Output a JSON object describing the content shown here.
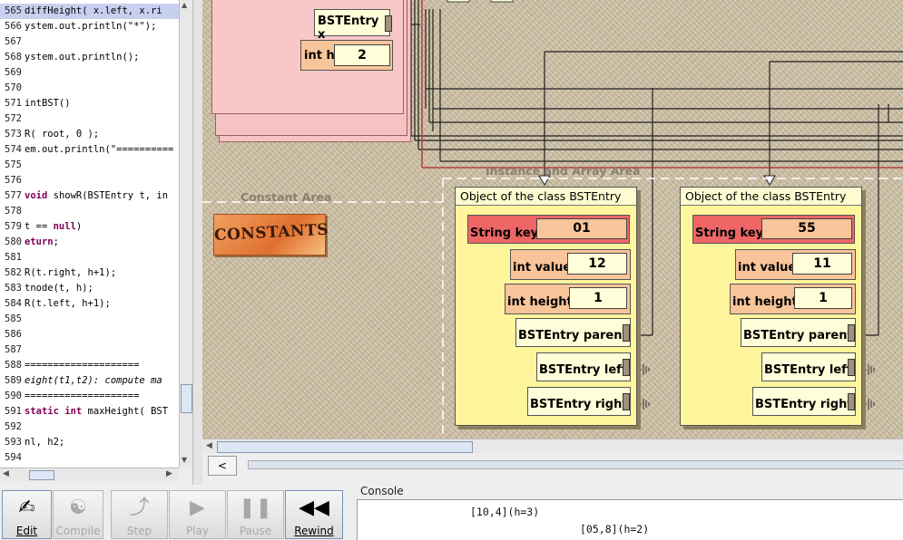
{
  "editor": {
    "lines": [
      {
        "num": "565",
        "text": " diffHeight( x.left, x.ri",
        "current": true
      },
      {
        "num": "566",
        "text": "ystem.out.println(\"*\");"
      },
      {
        "num": "567",
        "text": ""
      },
      {
        "num": "568",
        "text": "ystem.out.println();"
      },
      {
        "num": "569",
        "text": ""
      },
      {
        "num": "570",
        "text": ""
      },
      {
        "num": "571",
        "text": "intBST()"
      },
      {
        "num": "572",
        "text": ""
      },
      {
        "num": "573",
        "text": "R( root, 0 );"
      },
      {
        "num": "574",
        "text": "em.out.println(\"=========="
      },
      {
        "num": "575",
        "text": ""
      },
      {
        "num": "576",
        "text": ""
      },
      {
        "num": "577",
        "pre": "",
        "kw": "void",
        "post": " showR(BSTEntry t, in"
      },
      {
        "num": "578",
        "text": ""
      },
      {
        "num": "579",
        "pre": "t == ",
        "kw": "null",
        "post": ")"
      },
      {
        "num": "580",
        "pre": "",
        "kw": "eturn",
        "post": ";"
      },
      {
        "num": "581",
        "text": ""
      },
      {
        "num": "582",
        "text": "R(t.right, h+1);"
      },
      {
        "num": "583",
        "text": "tnode(t, h);"
      },
      {
        "num": "584",
        "text": "R(t.left, h+1);"
      },
      {
        "num": "585",
        "text": ""
      },
      {
        "num": "586",
        "text": ""
      },
      {
        "num": "587",
        "text": ""
      },
      {
        "num": "588",
        "text": "===================="
      },
      {
        "num": "589",
        "text": "eight(t1,t2): compute ma",
        "italic": true
      },
      {
        "num": "590",
        "text": "===================="
      },
      {
        "num": "591",
        "pre": "",
        "kw": "static int",
        "post": " maxHeight( BST"
      },
      {
        "num": "592",
        "text": ""
      },
      {
        "num": "593",
        "text": "nl, h2;"
      },
      {
        "num": "594",
        "text": ""
      }
    ]
  },
  "canvas": {
    "stack_frame": {
      "bstentry_label": "BSTEntry x",
      "int_h_label": "int h",
      "int_h_value": "2"
    },
    "constant_area_label": "Constant Area",
    "instance_area_label": "Instance and Array Area",
    "constants_logo_text": "CONSTANTS",
    "objects": [
      {
        "title": "Object of the class BSTEntry",
        "key_label": "String key",
        "key_value": "01",
        "value_label": "int value",
        "value_value": "12",
        "height_label": "int height",
        "height_value": "1",
        "parent_label": "BSTEntry parent",
        "left_label": "BSTEntry left",
        "right_label": "BSTEntry right"
      },
      {
        "title": "Object of the class BSTEntry",
        "key_label": "String key",
        "key_value": "55",
        "value_label": "int value",
        "value_value": "11",
        "height_label": "int height",
        "height_value": "1",
        "parent_label": "BSTEntry parent",
        "left_label": "BSTEntry left",
        "right_label": "BSTEntry right"
      }
    ]
  },
  "history": {
    "back_label": "<"
  },
  "toolbar": {
    "buttons": [
      {
        "label": "Edit",
        "icon": "edit-icon",
        "enabled": true
      },
      {
        "label": "Compile",
        "icon": "yin-yang-icon",
        "enabled": false
      },
      {
        "label": "Step",
        "icon": "step-icon",
        "enabled": false
      },
      {
        "label": "Play",
        "icon": "play-icon",
        "enabled": false
      },
      {
        "label": "Pause",
        "icon": "pause-icon",
        "enabled": false
      },
      {
        "label": "Rewind",
        "icon": "rewind-icon",
        "enabled": true
      }
    ]
  },
  "console": {
    "title": "Console",
    "lines": [
      "[10,4](h=3)",
      "[05,8](h=2)"
    ]
  },
  "colors": {
    "key_field": "#ee6666",
    "value_field": "#f8c49a",
    "reference_line": "#b04040",
    "object_bg": "#fff59c"
  }
}
